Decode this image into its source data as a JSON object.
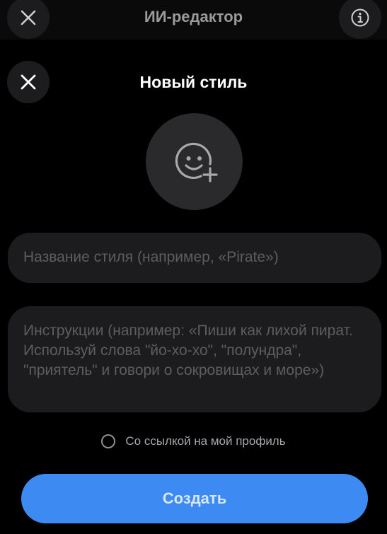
{
  "app": {
    "title": "ИИ-редактор"
  },
  "top_bar": {
    "close_icon": "close-icon",
    "info_icon": "info-icon"
  },
  "sheet": {
    "title": "Новый стиль",
    "close_icon": "close-icon"
  },
  "avatar": {
    "icon": "add-emoji-icon"
  },
  "form": {
    "name_placeholder": "Название стиля (например, «Pirate»)",
    "instructions_placeholder": "Инструкции (например: «Пиши как лихой пират. Используй слова \"йо-хо-хо\", \"полундра\", \"приятель\" и говори о сокровищах и море»)",
    "link_profile_label": "Со ссылкой на мой профиль"
  },
  "actions": {
    "create_label": "Создать"
  },
  "colors": {
    "background": "#000000",
    "field": "#1c1c1e",
    "accent": "#3d8bf2"
  }
}
